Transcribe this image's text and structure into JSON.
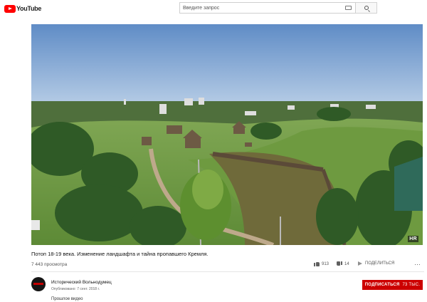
{
  "header": {
    "logo_text": "YouTube",
    "search_placeholder": "Введите запрос"
  },
  "video": {
    "title": "Потоп 18-19 века. Изменение ландшафта и тайна пропавшего Кремля.",
    "views": "7 443 просмотра",
    "watermark": "HR",
    "likes": "913",
    "dislikes": "14",
    "share_label": "ПОДЕЛИТЬСЯ",
    "more_label": "…"
  },
  "channel": {
    "name": "Исторический Вольнодумец",
    "published": "Опубликовано: 7 сент. 2018 г.",
    "subscribe_label": "ПОДПИСАТЬСЯ",
    "subscriber_count": "73 ТЫС."
  },
  "description": {
    "first_line": "Прошлое видео"
  },
  "colors": {
    "brand_red": "#ff0000",
    "subscribe_red": "#cc0000"
  }
}
